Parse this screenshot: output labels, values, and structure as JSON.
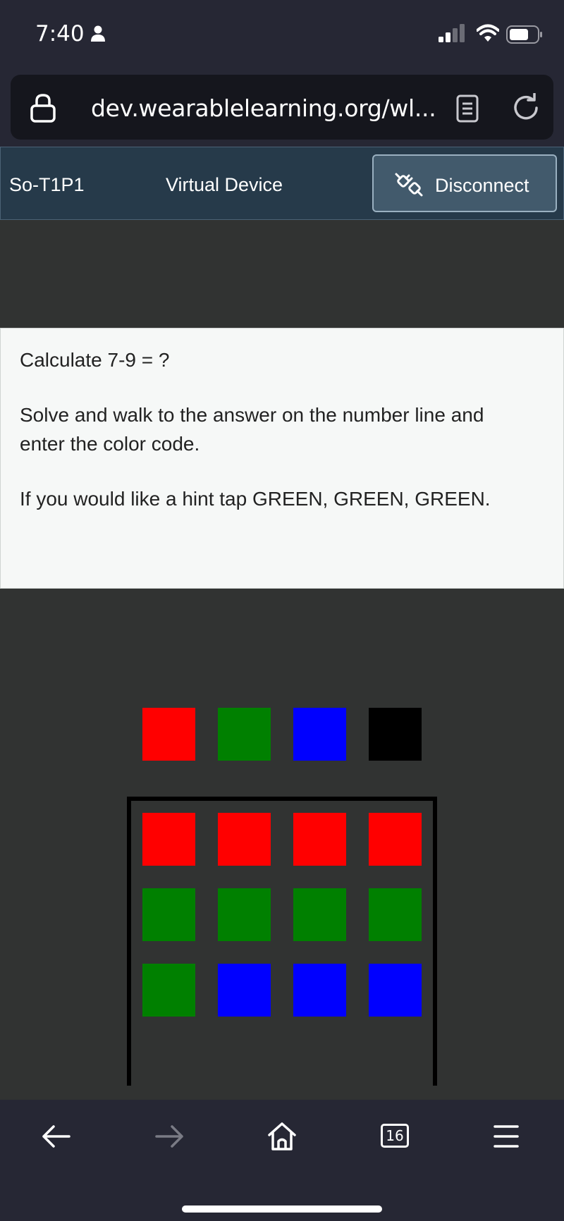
{
  "status_bar": {
    "time": "7:40"
  },
  "browser": {
    "url": "dev.wearablelearning.org/wl...",
    "tab_count": "16"
  },
  "header": {
    "player_id": "So-T1P1",
    "device_label": "Virtual Device",
    "disconnect_label": "Disconnect"
  },
  "prompt": {
    "line1": "Calculate 7-9 = ?",
    "line2": "Solve and walk to the answer on the number line and\nenter the color code.",
    "line3": "If you would like a hint tap GREEN, GREEN, GREEN."
  },
  "colors": {
    "red": "#ff0000",
    "green": "#008000",
    "blue": "#0000ff",
    "black": "#000000",
    "header_bg": "#263a4a",
    "chrome_bg": "#262734"
  },
  "color_buttons": [
    "red",
    "green",
    "blue",
    "black"
  ],
  "entered_code": [
    [
      "red",
      "red",
      "red",
      "red"
    ],
    [
      "green",
      "green",
      "green",
      "green"
    ],
    [
      "green",
      "blue",
      "blue",
      "blue"
    ]
  ]
}
